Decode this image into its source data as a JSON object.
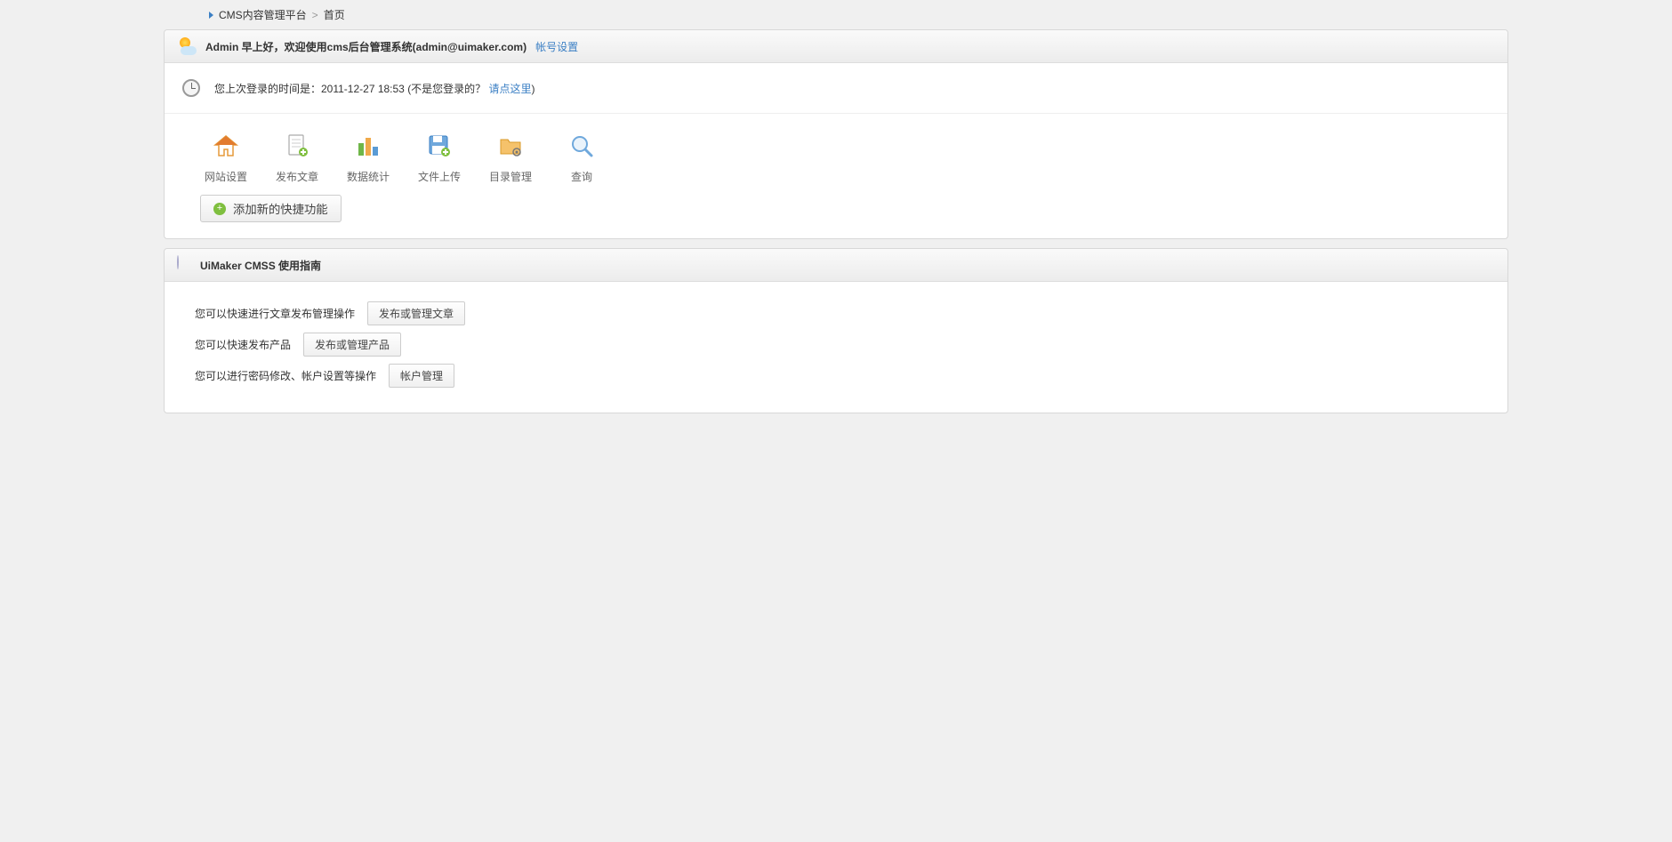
{
  "breadcrumb": {
    "root": "CMS内容管理平台",
    "sep": ">",
    "current": "首页"
  },
  "welcome": {
    "greeting": "Admin 早上好，欢迎使用cms后台管理系统(admin@uimaker.com)",
    "settings_link": "帐号设置"
  },
  "login_info": {
    "prefix": "您上次登录的时间是：2011-12-27 18:53 (不是您登录的？",
    "link": "请点这里",
    "suffix": ")"
  },
  "shortcuts": [
    {
      "label": "网站设置"
    },
    {
      "label": "发布文章"
    },
    {
      "label": "数据统计"
    },
    {
      "label": "文件上传"
    },
    {
      "label": "目录管理"
    },
    {
      "label": "查询"
    }
  ],
  "add_shortcut_label": "添加新的快捷功能",
  "guide": {
    "title": "UiMaker CMSS 使用指南",
    "rows": [
      {
        "desc": "您可以快速进行文章发布管理操作",
        "btn": "发布或管理文章"
      },
      {
        "desc": "您可以快速发布产品",
        "btn": "发布或管理产品"
      },
      {
        "desc": "您可以进行密码修改、帐户设置等操作",
        "btn": "帐户管理"
      }
    ]
  }
}
